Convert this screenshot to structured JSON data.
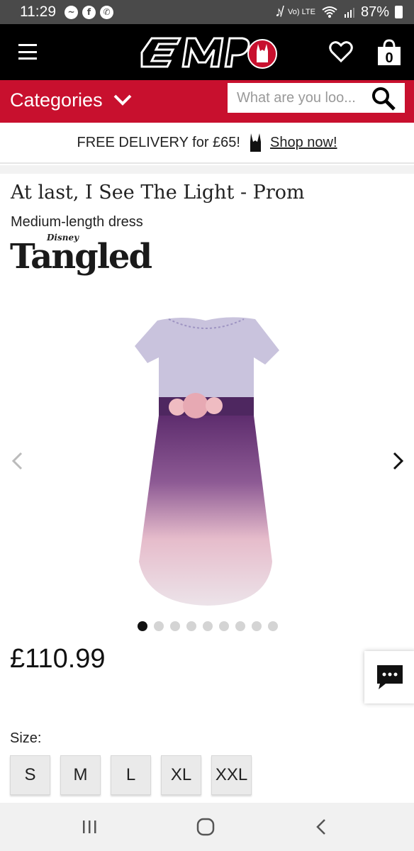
{
  "status_bar": {
    "time": "11:29",
    "notification_icons": [
      "messenger-icon",
      "facebook-icon",
      "whatsapp-icon"
    ],
    "battery": "87%",
    "network": "Vo) LTE"
  },
  "header": {
    "logo_text": "EMP",
    "cart_count": "0"
  },
  "category_bar": {
    "categories_label": "Categories",
    "search_placeholder": "What are you loo..."
  },
  "banner": {
    "delivery_text": "FREE DELIVERY for £65!",
    "shop_link": "Shop now!"
  },
  "product": {
    "title": "At last, I See The Light - Prom",
    "subtitle": "Medium-length dress",
    "brand_top": "Disney",
    "brand_name": "Tangled",
    "price": "£110.99",
    "image_count": 9,
    "active_image": 1
  },
  "size_selector": {
    "label": "Size:",
    "options": [
      "S",
      "M",
      "L",
      "XL",
      "XXL"
    ]
  },
  "colors": {
    "header_bg": "#000000",
    "accent_red": "#c8102e",
    "status_bar_bg": "#4a4a4a"
  }
}
